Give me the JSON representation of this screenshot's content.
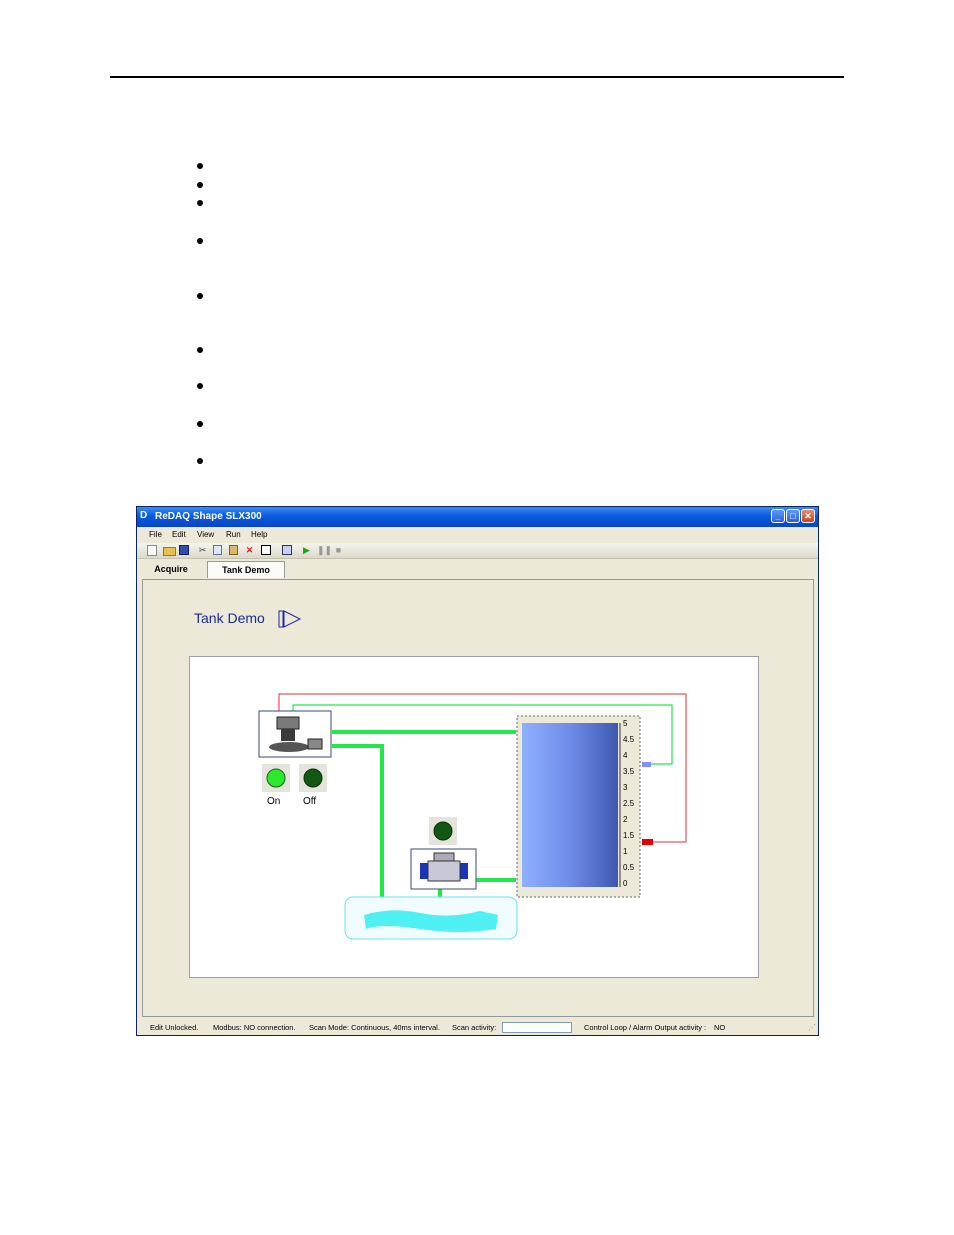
{
  "window": {
    "title": "ReDAQ Shape SLX300",
    "logo": "D",
    "buttons": [
      "minimize",
      "maximize",
      "close"
    ]
  },
  "menu": [
    "File",
    "Edit",
    "View",
    "Run",
    "Help"
  ],
  "toolbar": [
    "new-icon",
    "open-icon",
    "save-icon",
    "cut-icon",
    "copy-icon",
    "paste-icon",
    "delete-icon",
    "properties-icon",
    "grid-icon",
    "run-icon",
    "pause-icon",
    "stop-icon"
  ],
  "tabs": [
    {
      "label": "Acquire",
      "active": false
    },
    {
      "label": "Tank Demo",
      "active": true
    }
  ],
  "page": {
    "title": "Tank Demo"
  },
  "indicators": {
    "on_label": "On",
    "off_label": "Off"
  },
  "tank": {
    "scale": [
      "5",
      "4.5",
      "4",
      "3.5",
      "3",
      "2.5",
      "2",
      "1.5",
      "1",
      "0.5",
      "0"
    ]
  },
  "status": {
    "edit": "Edit Unlocked.",
    "modbus": "Modbus: NO connection.",
    "scan_mode": "Scan Mode: Continuous, 40ms interval.",
    "scan_activity": "Scan activity:",
    "control_loop": "Control Loop / Alarm Output activity :",
    "control_value": "NO"
  },
  "colors": {
    "pipe": "#22e84a",
    "wire_red": "#e43030",
    "tank_fill": "#6f8ce8",
    "accent": "#1c2c9c"
  }
}
